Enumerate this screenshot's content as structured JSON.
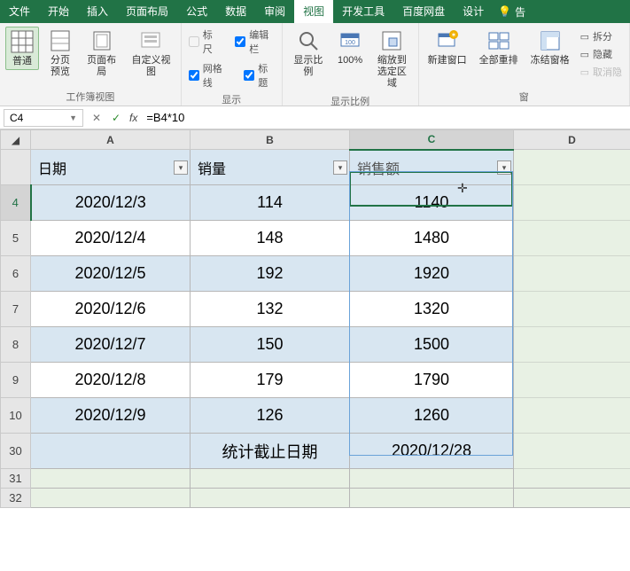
{
  "tabs": {
    "file": "文件",
    "home": "开始",
    "insert": "插入",
    "layout": "页面布局",
    "formulas": "公式",
    "data": "数据",
    "review": "审阅",
    "view": "视图",
    "developer": "开发工具",
    "baidu": "百度网盘",
    "design": "设计",
    "tellme": "告"
  },
  "ribbon": {
    "normal": "普通",
    "pagebreak": "分页\n预览",
    "pagelayout": "页面布局",
    "custom": "自定义视图",
    "group_views": "工作簿视图",
    "ruler": "标尺",
    "formula_bar": "编辑栏",
    "gridlines": "网格线",
    "headings": "标题",
    "group_show": "显示",
    "zoom": "显示比例",
    "zoom100": "100%",
    "zoom_sel": "缩放到\n选定区域",
    "group_zoom": "显示比例",
    "new_window": "新建窗口",
    "arrange": "全部重排",
    "freeze": "冻结窗格",
    "split": "拆分",
    "hide": "隐藏",
    "unhide": "取消隐",
    "group_window": "窗"
  },
  "fbar": {
    "namebox": "C4",
    "formula": "=B4*10"
  },
  "sheet": {
    "colA": "A",
    "colB": "B",
    "colC": "C",
    "colD": "D",
    "headers": {
      "a": "日期",
      "b": "销量",
      "c": "销售额"
    },
    "rows": [
      {
        "n": "4",
        "a": "2020/12/3",
        "b": "114",
        "c": "1140"
      },
      {
        "n": "5",
        "a": "2020/12/4",
        "b": "148",
        "c": "1480"
      },
      {
        "n": "6",
        "a": "2020/12/5",
        "b": "192",
        "c": "1920"
      },
      {
        "n": "7",
        "a": "2020/12/6",
        "b": "132",
        "c": "1320"
      },
      {
        "n": "8",
        "a": "2020/12/7",
        "b": "150",
        "c": "1500"
      },
      {
        "n": "9",
        "a": "2020/12/8",
        "b": "179",
        "c": "1790"
      },
      {
        "n": "10",
        "a": "2020/12/9",
        "b": "126",
        "c": "1260"
      }
    ],
    "footer": {
      "n": "30",
      "b": "统计截止日期",
      "c": "2020/12/28"
    },
    "extra_rows": [
      "31",
      "32"
    ]
  }
}
